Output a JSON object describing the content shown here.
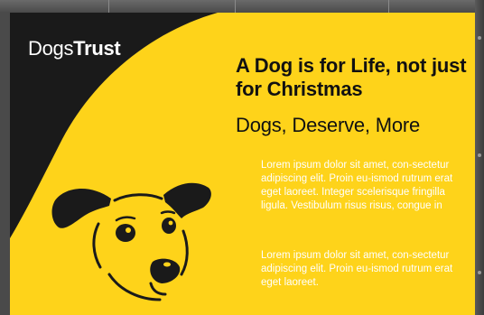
{
  "poster": {
    "brand": {
      "word1": "Dogs",
      "word2": "Trust"
    },
    "headline": "A Dog is for Life, not just for Christmas",
    "subhead": "Dogs, Deserve, More",
    "paragraphs": [
      "Lorem ipsum dolor sit amet, con-sectetur adipiscing elit. Proin eu-ismod rutrum erat eget laoreet. Integer scelerisque fringilla ligula. Vestibulum risus risus, congue in",
      "Lorem ipsum dolor sit amet, con-sectetur adipiscing elit. Proin eu-ismod rutrum erat eget laoreet."
    ],
    "colors": {
      "yellow": "#fed31a",
      "black": "#1a1a1a",
      "white": "#ffffff",
      "frame": "#4a4a4a"
    },
    "icons": [
      "dog-face-icon"
    ]
  }
}
